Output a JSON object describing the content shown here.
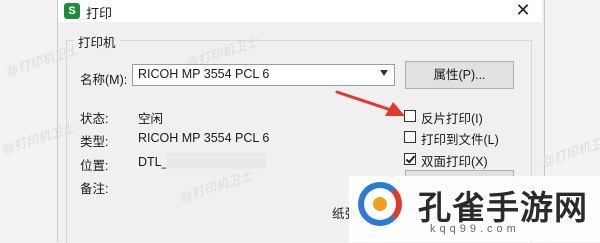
{
  "dialog": {
    "app_icon_letter": "S",
    "title": "打印",
    "close_glyph": "✕"
  },
  "printer_group": {
    "label": "打印机",
    "name_label": "名称(M):",
    "selected_printer": "RICOH MP 3554 PCL 6",
    "properties_button": "属性(P)...",
    "status_label": "状态:",
    "status_value": "空闲",
    "type_label": "类型:",
    "type_value": "RICOH MP 3554 PCL 6",
    "location_label": "位置:",
    "location_value": "DTL_",
    "comment_label": "备注:",
    "paper_label": "纸张"
  },
  "options": [
    {
      "label": "反片打印(I)",
      "checked": false
    },
    {
      "label": "打印到文件(L)",
      "checked": false
    },
    {
      "label": "双面打印(X)",
      "checked": true
    }
  ],
  "watermark_text": "@打印机卫士",
  "overlay_logo": {
    "main": "孔雀手游网",
    "sub": "kqq99.com"
  },
  "colors": {
    "annotation_arrow": "#e23a2a",
    "app_icon": "#1e8e3e"
  }
}
